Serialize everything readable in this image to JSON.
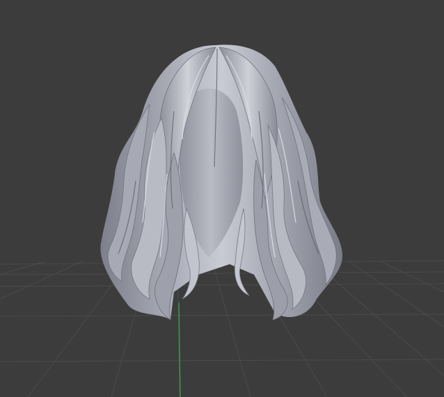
{
  "viewport": {
    "background_color": "#3c3c3c",
    "grid_line_color": "#4a4a4a",
    "y_axis_color": "#3ea843",
    "model": {
      "icon": "hair-mesh",
      "base_color": "#a4a6b2",
      "highlight_color": "#d6d8e0",
      "shadow_color": "#6f717c"
    }
  }
}
